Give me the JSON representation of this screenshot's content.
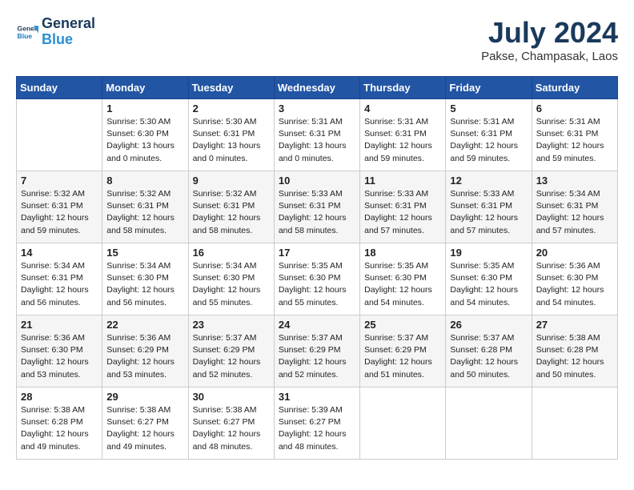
{
  "header": {
    "logo_line1": "General",
    "logo_line2": "Blue",
    "month_year": "July 2024",
    "location": "Pakse, Champasak, Laos"
  },
  "weekdays": [
    "Sunday",
    "Monday",
    "Tuesday",
    "Wednesday",
    "Thursday",
    "Friday",
    "Saturday"
  ],
  "weeks": [
    [
      {
        "day": "",
        "info": ""
      },
      {
        "day": "1",
        "info": "Sunrise: 5:30 AM\nSunset: 6:30 PM\nDaylight: 13 hours\nand 0 minutes."
      },
      {
        "day": "2",
        "info": "Sunrise: 5:30 AM\nSunset: 6:31 PM\nDaylight: 13 hours\nand 0 minutes."
      },
      {
        "day": "3",
        "info": "Sunrise: 5:31 AM\nSunset: 6:31 PM\nDaylight: 13 hours\nand 0 minutes."
      },
      {
        "day": "4",
        "info": "Sunrise: 5:31 AM\nSunset: 6:31 PM\nDaylight: 12 hours\nand 59 minutes."
      },
      {
        "day": "5",
        "info": "Sunrise: 5:31 AM\nSunset: 6:31 PM\nDaylight: 12 hours\nand 59 minutes."
      },
      {
        "day": "6",
        "info": "Sunrise: 5:31 AM\nSunset: 6:31 PM\nDaylight: 12 hours\nand 59 minutes."
      }
    ],
    [
      {
        "day": "7",
        "info": "Sunrise: 5:32 AM\nSunset: 6:31 PM\nDaylight: 12 hours\nand 59 minutes."
      },
      {
        "day": "8",
        "info": "Sunrise: 5:32 AM\nSunset: 6:31 PM\nDaylight: 12 hours\nand 58 minutes."
      },
      {
        "day": "9",
        "info": "Sunrise: 5:32 AM\nSunset: 6:31 PM\nDaylight: 12 hours\nand 58 minutes."
      },
      {
        "day": "10",
        "info": "Sunrise: 5:33 AM\nSunset: 6:31 PM\nDaylight: 12 hours\nand 58 minutes."
      },
      {
        "day": "11",
        "info": "Sunrise: 5:33 AM\nSunset: 6:31 PM\nDaylight: 12 hours\nand 57 minutes."
      },
      {
        "day": "12",
        "info": "Sunrise: 5:33 AM\nSunset: 6:31 PM\nDaylight: 12 hours\nand 57 minutes."
      },
      {
        "day": "13",
        "info": "Sunrise: 5:34 AM\nSunset: 6:31 PM\nDaylight: 12 hours\nand 57 minutes."
      }
    ],
    [
      {
        "day": "14",
        "info": "Sunrise: 5:34 AM\nSunset: 6:31 PM\nDaylight: 12 hours\nand 56 minutes."
      },
      {
        "day": "15",
        "info": "Sunrise: 5:34 AM\nSunset: 6:30 PM\nDaylight: 12 hours\nand 56 minutes."
      },
      {
        "day": "16",
        "info": "Sunrise: 5:34 AM\nSunset: 6:30 PM\nDaylight: 12 hours\nand 55 minutes."
      },
      {
        "day": "17",
        "info": "Sunrise: 5:35 AM\nSunset: 6:30 PM\nDaylight: 12 hours\nand 55 minutes."
      },
      {
        "day": "18",
        "info": "Sunrise: 5:35 AM\nSunset: 6:30 PM\nDaylight: 12 hours\nand 54 minutes."
      },
      {
        "day": "19",
        "info": "Sunrise: 5:35 AM\nSunset: 6:30 PM\nDaylight: 12 hours\nand 54 minutes."
      },
      {
        "day": "20",
        "info": "Sunrise: 5:36 AM\nSunset: 6:30 PM\nDaylight: 12 hours\nand 54 minutes."
      }
    ],
    [
      {
        "day": "21",
        "info": "Sunrise: 5:36 AM\nSunset: 6:30 PM\nDaylight: 12 hours\nand 53 minutes."
      },
      {
        "day": "22",
        "info": "Sunrise: 5:36 AM\nSunset: 6:29 PM\nDaylight: 12 hours\nand 53 minutes."
      },
      {
        "day": "23",
        "info": "Sunrise: 5:37 AM\nSunset: 6:29 PM\nDaylight: 12 hours\nand 52 minutes."
      },
      {
        "day": "24",
        "info": "Sunrise: 5:37 AM\nSunset: 6:29 PM\nDaylight: 12 hours\nand 52 minutes."
      },
      {
        "day": "25",
        "info": "Sunrise: 5:37 AM\nSunset: 6:29 PM\nDaylight: 12 hours\nand 51 minutes."
      },
      {
        "day": "26",
        "info": "Sunrise: 5:37 AM\nSunset: 6:28 PM\nDaylight: 12 hours\nand 50 minutes."
      },
      {
        "day": "27",
        "info": "Sunrise: 5:38 AM\nSunset: 6:28 PM\nDaylight: 12 hours\nand 50 minutes."
      }
    ],
    [
      {
        "day": "28",
        "info": "Sunrise: 5:38 AM\nSunset: 6:28 PM\nDaylight: 12 hours\nand 49 minutes."
      },
      {
        "day": "29",
        "info": "Sunrise: 5:38 AM\nSunset: 6:27 PM\nDaylight: 12 hours\nand 49 minutes."
      },
      {
        "day": "30",
        "info": "Sunrise: 5:38 AM\nSunset: 6:27 PM\nDaylight: 12 hours\nand 48 minutes."
      },
      {
        "day": "31",
        "info": "Sunrise: 5:39 AM\nSunset: 6:27 PM\nDaylight: 12 hours\nand 48 minutes."
      },
      {
        "day": "",
        "info": ""
      },
      {
        "day": "",
        "info": ""
      },
      {
        "day": "",
        "info": ""
      }
    ]
  ]
}
